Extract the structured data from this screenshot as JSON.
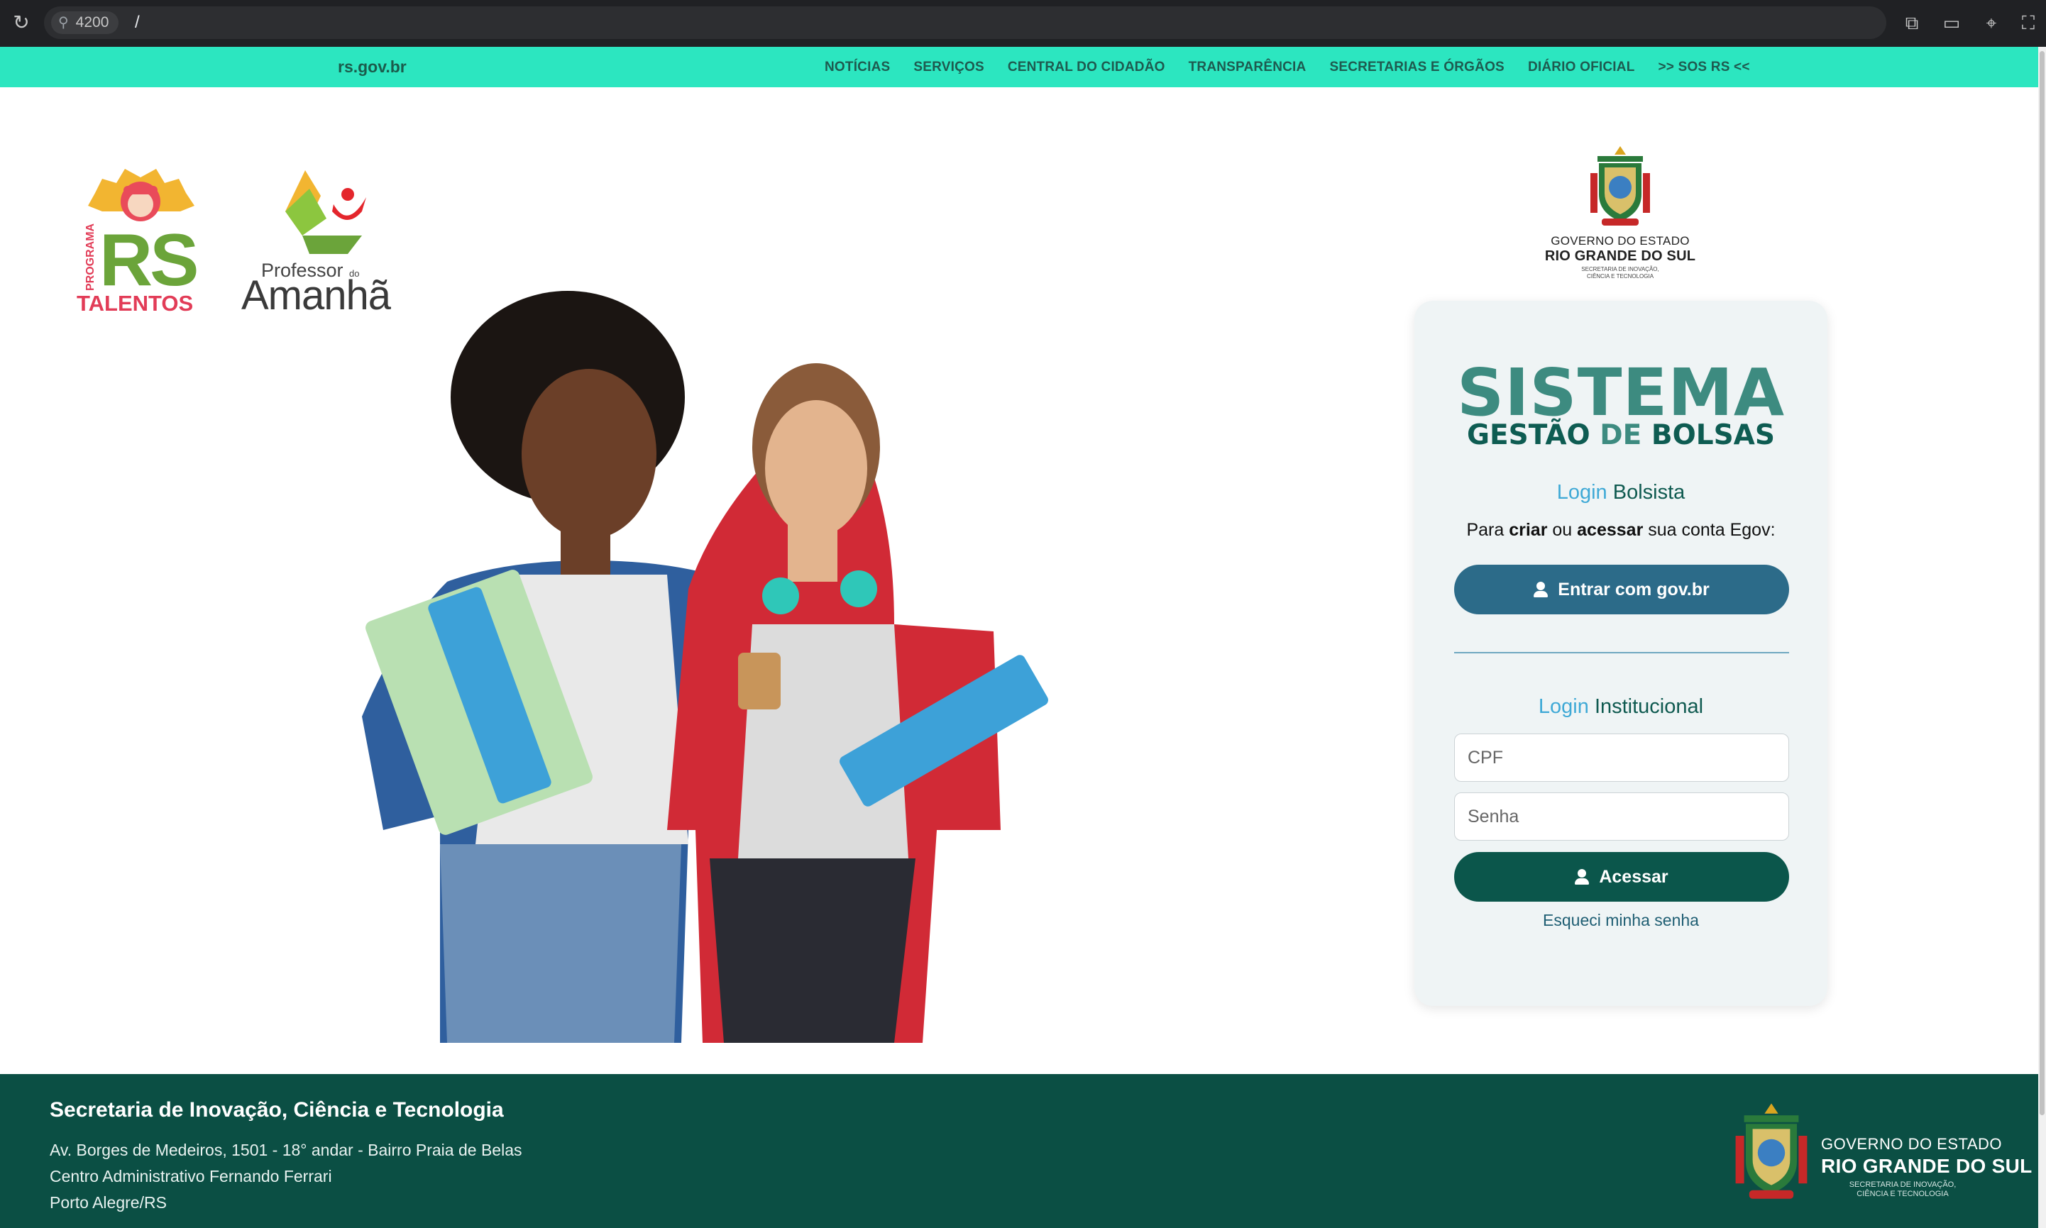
{
  "browser": {
    "reload_icon": "reload-icon",
    "port": "4200",
    "path": "/",
    "icons": [
      "open-external-icon",
      "device-toggle-icon",
      "inspect-pointer-icon",
      "fullscreen-icon"
    ]
  },
  "govbar": {
    "brand": "rs.gov.br",
    "nav": [
      "NOTÍCIAS",
      "SERVIÇOS",
      "CENTRAL DO CIDADÃO",
      "TRANSPARÊNCIA",
      "SECRETARIAS E ÓRGÃOS",
      "DIÁRIO OFICIAL",
      ">> SOS RS <<"
    ],
    "color": "#2ce6c0"
  },
  "logos": {
    "rs_talentos": {
      "programa": "PROGRAMA",
      "rs": "RS",
      "talentos": "TALENTOS"
    },
    "professor": {
      "professor": "Professor",
      "do": "do",
      "amanha": "Amanhã"
    }
  },
  "crest": {
    "line1": "GOVERNO DO ESTADO",
    "line2": "RIO GRANDE DO SUL",
    "line3": "SECRETARIA DE INOVAÇÃO,",
    "line4": "CIÊNCIA E TECNOLOGIA"
  },
  "login": {
    "title": "SISTEMA",
    "subtitle_a": "GESTÃO",
    "subtitle_de": "DE",
    "subtitle_b": "BOLSAS",
    "bolsista_login": "Login",
    "bolsista_label": "Bolsista",
    "instruction_pre": "Para ",
    "instruction_criar": "criar",
    "instruction_mid": " ou ",
    "instruction_acessar": "acessar",
    "instruction_post": " sua conta Egov:",
    "gov_button": "Entrar com gov.br",
    "inst_login": "Login",
    "inst_label": "Institucional",
    "cpf_placeholder": "CPF",
    "senha_placeholder": "Senha",
    "acessar_button": "Acessar",
    "forgot": "Esqueci minha senha",
    "colors": {
      "primary": "#0b564b",
      "gov_button": "#2c6b89",
      "accent": "#3d8b80",
      "link": "#3fa9d6"
    }
  },
  "footer": {
    "title": "Secretaria de Inovação, Ciência e Tecnologia",
    "address": "Av. Borges de Medeiros, 1501 - 18° andar - Bairro Praia de Belas",
    "building": "Centro Administrativo Fernando Ferrari",
    "city": "Porto Alegre/RS",
    "gov_line1": "GOVERNO DO ESTADO",
    "gov_line2": "RIO GRANDE DO SUL",
    "gov_line3": "SECRETARIA DE INOVAÇÃO,",
    "gov_line4": "CIÊNCIA E TECNOLOGIA",
    "color": "#0b4f44"
  }
}
